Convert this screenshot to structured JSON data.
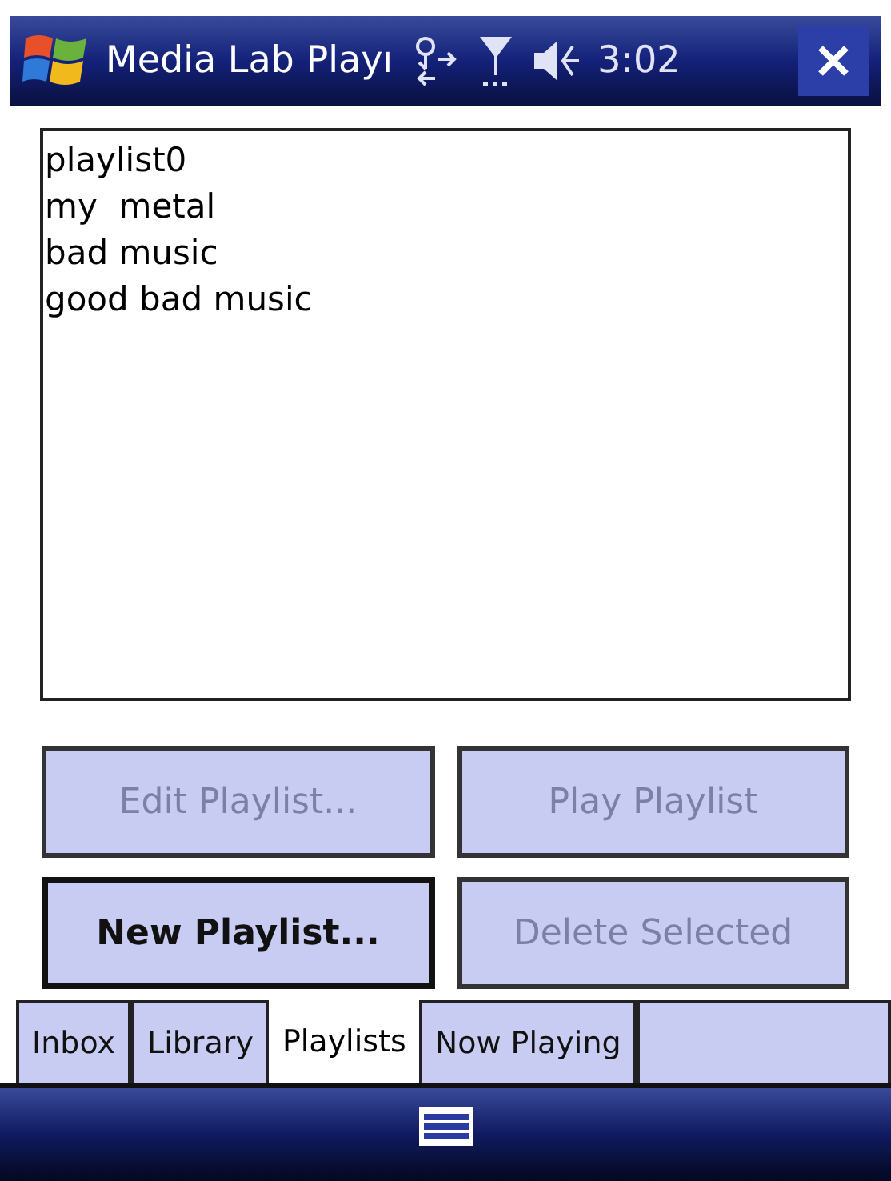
{
  "title_bar": {
    "title": "Media Lab Playı",
    "time": "3:02"
  },
  "playlists": [
    {
      "name": "playlist0",
      "selected": false
    },
    {
      "name": "my  metal",
      "selected": false
    },
    {
      "name": "bad music",
      "selected": false
    },
    {
      "name": "good bad music",
      "selected": false
    }
  ],
  "buttons": [
    {
      "label": "Edit Playlist...",
      "disabled": true,
      "default": false
    },
    {
      "label": "Play Playlist",
      "disabled": true,
      "default": false
    },
    {
      "label": "New Playlist...",
      "disabled": false,
      "default": true
    },
    {
      "label": "Delete Selected",
      "disabled": true,
      "default": false
    }
  ],
  "tabs": [
    {
      "label": "Inbox",
      "selected": false
    },
    {
      "label": "Library",
      "selected": false
    },
    {
      "label": "Playlists",
      "selected": true
    },
    {
      "label": "Now Playing",
      "selected": false
    }
  ]
}
